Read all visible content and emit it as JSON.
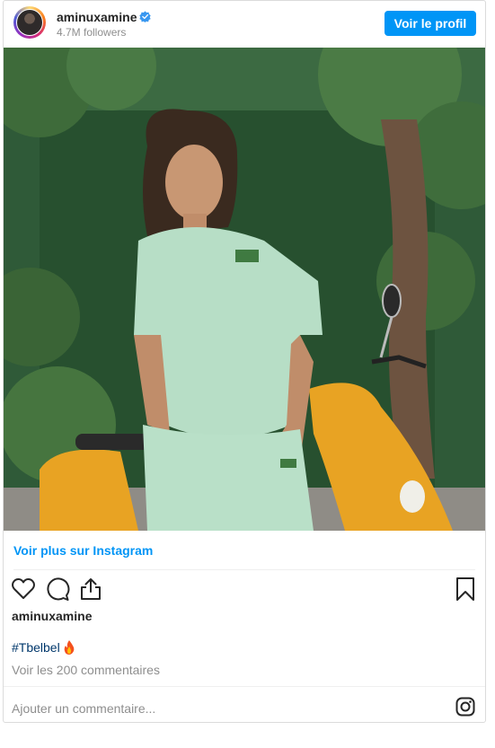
{
  "header": {
    "username": "aminuxamine",
    "followers": "4.7M followers",
    "profile_button": "Voir le profil"
  },
  "post": {
    "see_more_link": "Voir plus sur Instagram",
    "caption_user": "aminuxamine",
    "hashtag": "#Tbelbel",
    "comments_link": "Voir les 200 commentaires",
    "add_comment_placeholder": "Ajouter un commentaire..."
  },
  "colors": {
    "accent": "#0095f6",
    "hashtag": "#00376b",
    "muted": "#8e8e8e"
  },
  "icons": [
    "heart-icon",
    "comment-icon",
    "share-icon",
    "bookmark-icon",
    "instagram-icon",
    "verified-badge-icon",
    "fire-emoji-icon"
  ]
}
